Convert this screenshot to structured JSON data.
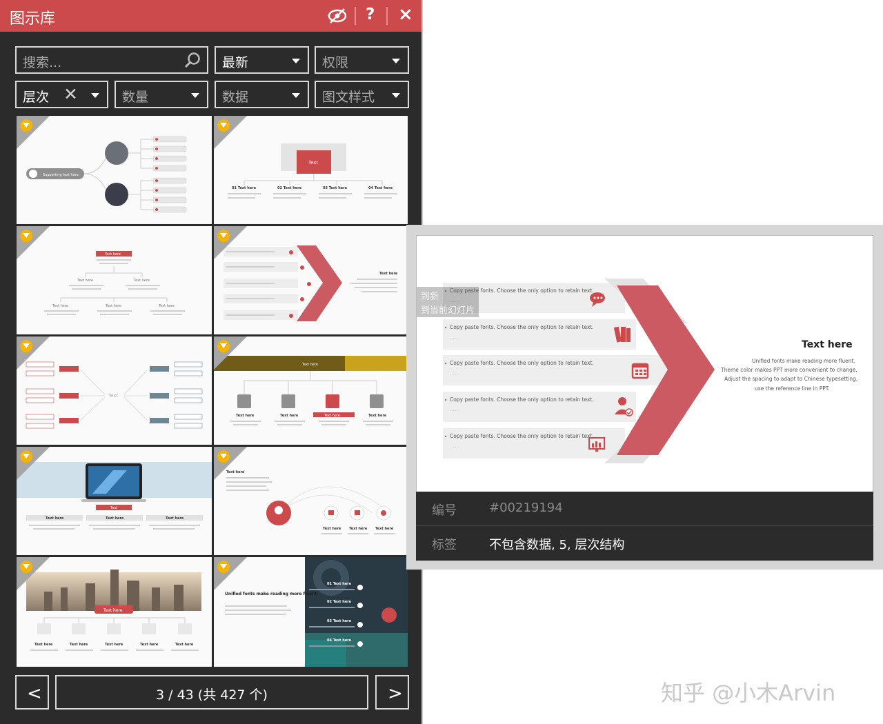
{
  "panel": {
    "title": "图示库",
    "icons": {
      "hide": "eye-slash-icon",
      "help": "?",
      "close": "×"
    }
  },
  "filters": {
    "search_placeholder": "搜索...",
    "sort": "最新",
    "permission": "权限",
    "level": "层次",
    "level_clear": "✕",
    "quantity": "数量",
    "data": "数据",
    "style": "图文样式"
  },
  "thumbnails": {
    "t1": {
      "label": "Supporting text here"
    },
    "t2": {
      "center": "Text",
      "cols": [
        "01 Text here",
        "02 Text here",
        "03 Text here",
        "04 Text here"
      ]
    },
    "t3": {
      "top": "Text here",
      "mid": [
        "Text here",
        "Text here"
      ],
      "bot": [
        "Text here",
        "Text here",
        "Text here"
      ]
    },
    "t4": {
      "title": "Text here"
    },
    "t5": {
      "center": "Text"
    },
    "t6": {
      "title": "Text here",
      "items": [
        "Text here",
        "Text here",
        "Text here",
        "Text here"
      ]
    },
    "t7": {
      "badge": "Text",
      "cols": [
        "Text here",
        "Text here",
        "Text here"
      ]
    },
    "t8": {
      "title": "Text here",
      "items": [
        "Text here",
        "Text here",
        "Text here"
      ]
    },
    "t9": {
      "badge": "Text here",
      "items": [
        "Text here",
        "Text here",
        "Text here",
        "Text here",
        "Text here"
      ]
    },
    "t10": {
      "headline": "Unified fonts make reading more fluent.",
      "items": [
        "01 Text here",
        "02 Text here",
        "03 Text here",
        "04 Text here"
      ]
    }
  },
  "pagination": {
    "prev": "<",
    "info": "3 / 43 (共 427 个)",
    "next": ">"
  },
  "preview": {
    "rows": [
      "Copy paste fonts. Choose the only option to retain text.",
      "Copy paste fonts. Choose the only option to retain text.",
      "Copy paste fonts. Choose the only option to retain text.",
      "Copy paste fonts. Choose the only option to retain text.",
      "Copy paste fonts. Choose the only option to retain text."
    ],
    "row_sub": "……",
    "heading": "Text here",
    "body": [
      "Unified fonts make reading more fluent.",
      "Theme color makes PPT more convenient to change.",
      "Adjust the spacing to adapt to Chinese typesetting,",
      "use the reference line in PPT."
    ],
    "tooltip": [
      "到新",
      "到当前幻灯片"
    ],
    "meta": {
      "id_label": "编号",
      "id_value": "#00219194",
      "tags_label": "标签",
      "tags_value": "不包含数据, 5, 层次结构"
    },
    "icons": [
      "chat-icon",
      "books-icon",
      "calendar-icon",
      "user-check-icon",
      "chart-icon"
    ]
  },
  "watermark": "知乎 @小木Arvin",
  "colors": {
    "accent": "#cc4a4c",
    "panel_bg": "#2b2b2b",
    "gem": "#f4b400"
  }
}
